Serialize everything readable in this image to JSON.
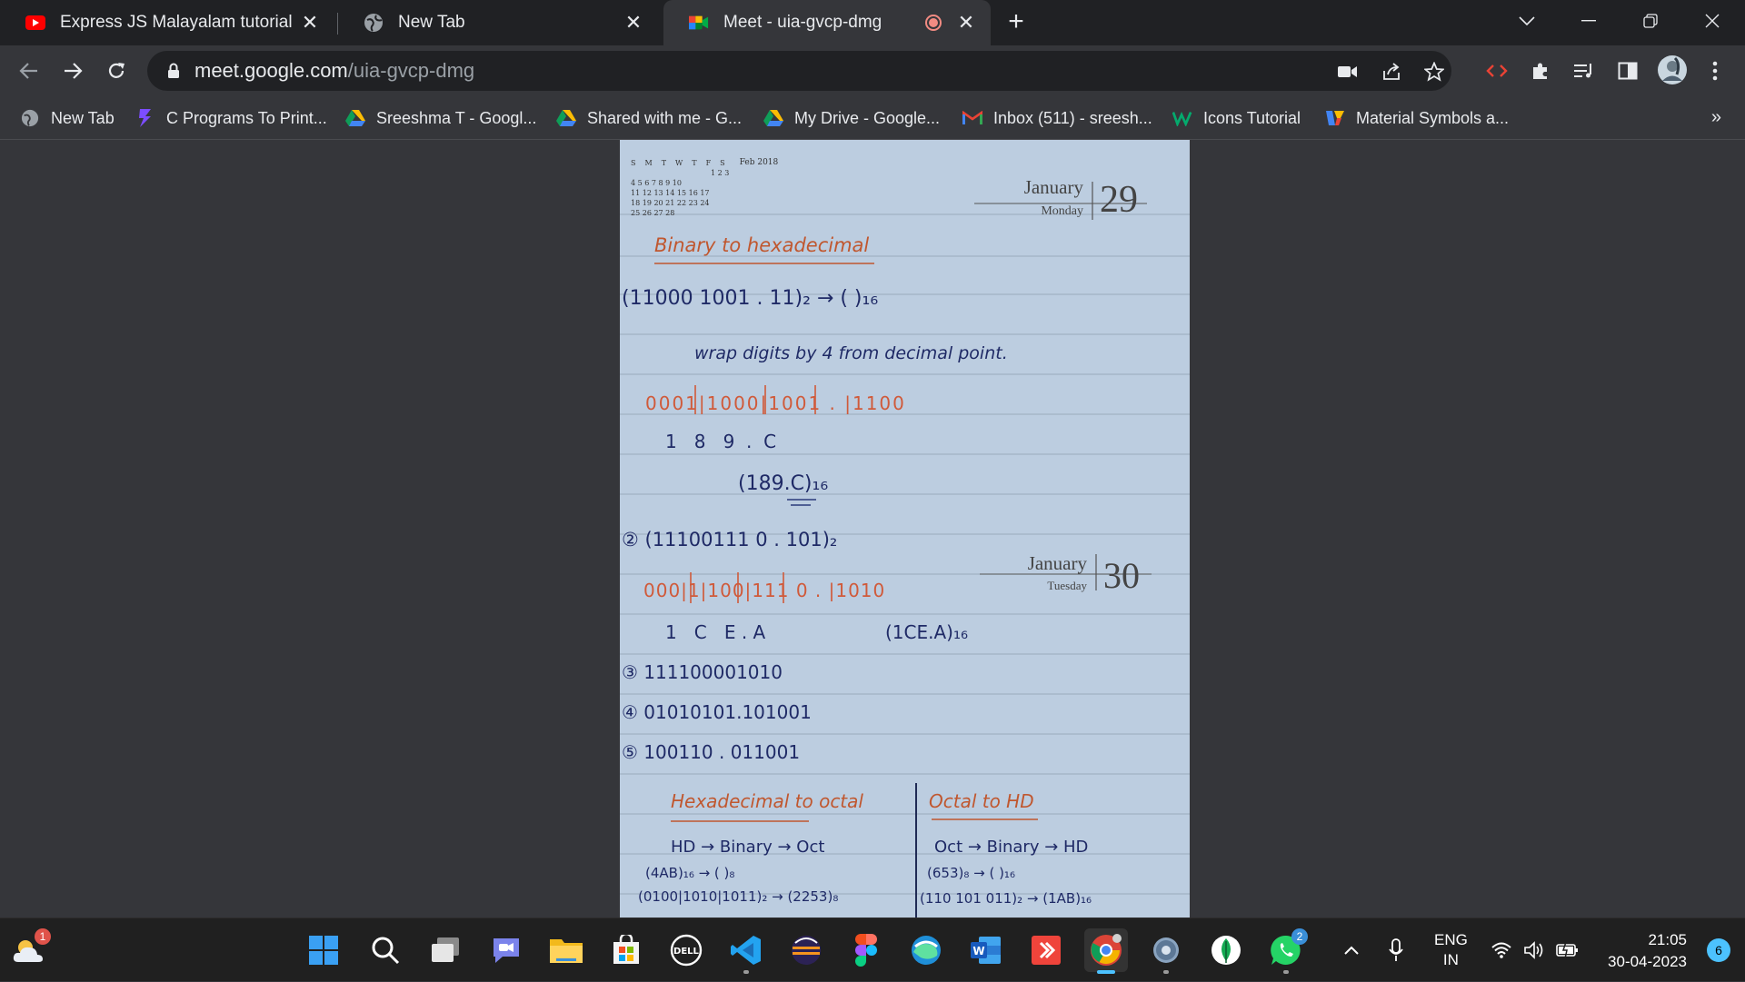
{
  "tabs": [
    {
      "title": "Express JS Malayalam tutorial | Pa",
      "icon": "youtube-icon"
    },
    {
      "title": "New Tab",
      "icon": "globe-icon"
    },
    {
      "title": "Meet - uia-gvcp-dmg",
      "icon": "google-meet-icon",
      "recording": true
    }
  ],
  "address_bar": {
    "host": "meet.google.com",
    "path": "/uia-gvcp-dmg"
  },
  "bookmarks": [
    {
      "label": "New Tab",
      "icon": "globe-icon"
    },
    {
      "label": "C Programs To Print...",
      "icon": "brand-icon"
    },
    {
      "label": "Sreeshma T - Googl...",
      "icon": "google-drive-icon"
    },
    {
      "label": "Shared with me - G...",
      "icon": "google-drive-icon"
    },
    {
      "label": "My Drive - Google...",
      "icon": "google-drive-icon"
    },
    {
      "label": "Inbox (511) - sreesh...",
      "icon": "gmail-icon"
    },
    {
      "label": "Icons Tutorial",
      "icon": "w3schools-icon"
    },
    {
      "label": "Material Symbols a...",
      "icon": "material-icon"
    }
  ],
  "bookmarks_overflow": "»",
  "notebook": {
    "mini_calendar_month": "Feb 2018",
    "mini_calendar_days": [
      "S",
      "M",
      "T",
      "W",
      "T",
      "F",
      "S"
    ],
    "mini_calendar_rows": [
      "1 2 3",
      "4 5 6 7 8 9 10",
      "11 12 13 14 15 16 17",
      "18 19 20 21 22 23 24",
      "25 26 27 28"
    ],
    "date1": {
      "month": "January",
      "weekday": "Monday",
      "day": "29"
    },
    "date2": {
      "month": "January",
      "weekday": "Tuesday",
      "day": "30"
    },
    "heading": "Binary to hexadecimal",
    "lines": [
      "(11000 1001 . 11)₂ → ( )₁₆",
      "wrap digits by 4 from decimal point.",
      "0001|1000|1001 . |1100",
      "1   8   9  .  C",
      "(189.C)₁₆",
      "② (11100111 0 . 101)₂",
      "000|1|100|111 0 . |1010",
      "1   C   E . A",
      "(1CE.A)₁₆",
      "③ 111100001010",
      "④ 01010101.101001",
      "⑤ 100110 . 011001",
      "Hexadecimal to octal",
      "Octal to HD",
      "HD → Binary → Oct",
      "Oct → Binary → HD",
      "(4AB)₁₆ → ( )₈",
      "(653)₈ → ( )₁₆",
      "(0100|1010|1011)₂ → (2253)₈",
      "(110 101 011)₂ → (1AB)₁₆"
    ]
  },
  "taskbar": {
    "weather_badge": "1",
    "whatsapp_badge": "2",
    "language_line1": "ENG",
    "language_line2": "IN",
    "time": "21:05",
    "date": "30-04-2023",
    "notifications": "6"
  }
}
